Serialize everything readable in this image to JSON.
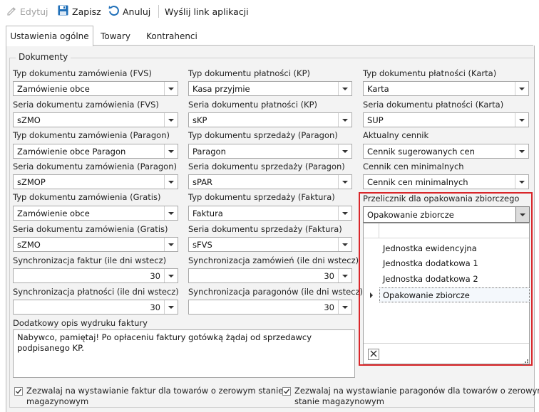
{
  "toolbar": {
    "edit_label": "Edytuj",
    "save_label": "Zapisz",
    "cancel_label": "Anuluj",
    "send_link_label": "Wyślij link aplikacji"
  },
  "tabs": [
    {
      "label": "Ustawienia ogólne",
      "active": true
    },
    {
      "label": "Towary",
      "active": false
    },
    {
      "label": "Kontrahenci",
      "active": false
    }
  ],
  "group_title": "Dokumenty",
  "fields": {
    "c1": [
      {
        "label": "Typ dokumentu zamówienia (FVS)",
        "value": "Zamówienie obce"
      },
      {
        "label": "Seria dokumentu zamówienia (FVS)",
        "value": "sZMO"
      },
      {
        "label": "Typ dokumentu zamówienia (Paragon)",
        "value": "Zamówienie obce Paragon"
      },
      {
        "label": "Seria dokumentu zamówienia (Paragon)",
        "value": "sZMOP"
      },
      {
        "label": "Typ dokumentu zamówienia (Gratis)",
        "value": "Zamówienie obce"
      },
      {
        "label": "Seria dokumentu zamówienia (Gratis)",
        "value": "sZMO"
      }
    ],
    "c2": [
      {
        "label": "Typ dokumentu płatności (KP)",
        "value": "Kasa przyjmie"
      },
      {
        "label": "Seria dokumentu płatności (KP)",
        "value": "sKP"
      },
      {
        "label": "Typ dokumentu sprzedaży (Paragon)",
        "value": "Paragon"
      },
      {
        "label": "Seria dokumentu sprzedaży (Paragon)",
        "value": "sPAR"
      },
      {
        "label": "Typ dokumentu sprzedaży (Faktura)",
        "value": "Faktura"
      },
      {
        "label": "Seria dokumentu sprzedaży (Faktura)",
        "value": "sFVS"
      }
    ],
    "c3": [
      {
        "label": "Typ dokumentu płatności (Karta)",
        "value": "Karta"
      },
      {
        "label": "Seria dokumentu płatności (Karta)",
        "value": "SUP"
      },
      {
        "label": "Aktualny cennik",
        "value": "Cennik sugerowanych cen"
      },
      {
        "label": "Cennik cen minimalnych",
        "value": "Cennik cen minimalnych"
      }
    ]
  },
  "sync": {
    "invoices": {
      "label": "Synchronizacja faktur (ile dni wstecz)",
      "value": "30"
    },
    "orders": {
      "label": "Synchronizacja zamówień (ile dni wstecz)",
      "value": "30"
    },
    "payments": {
      "label": "Synchronizacja płatności (ile dni wstecz)",
      "value": "30"
    },
    "receipts": {
      "label": "Synchronizacja paragonów (ile dni wstecz)",
      "value": "30"
    }
  },
  "extra_desc": {
    "label": "Dodatkowy opis wydruku faktury",
    "line1": "Nabywco, pamiętaj! Po opłaceniu faktury gotówką żądaj od sprzedawcy",
    "line2": "podpisanego KP."
  },
  "packaging": {
    "label": "Przelicznik dla opakowania zbiorczego",
    "value": "Opakowanie zbiorcze",
    "options": [
      "Jednostka ewidencyjna",
      "Jednostka dodatkowa 1",
      "Jednostka dodatkowa 2",
      "Opakowanie zbiorcze"
    ],
    "selected_index": 3
  },
  "checkboxes": {
    "invoices_zero_stock": {
      "line1": "Zezwalaj na wystawianie faktur dla towarów o zerowym stanie",
      "line2": "magazynowym",
      "checked": true
    },
    "receipts_zero_stock": {
      "line1": "Zezwalaj na wystawianie paragonów dla towarów o zerowym",
      "line2": "stanie magazynowym",
      "checked": true
    }
  },
  "colors": {
    "accent_red": "#d9262a",
    "save_blue": "#1f6fb8"
  }
}
